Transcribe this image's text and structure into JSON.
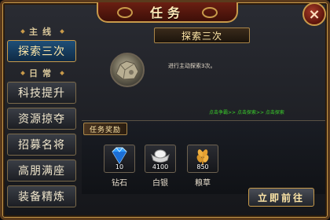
{
  "window": {
    "title": "任务",
    "close_label": "×"
  },
  "sidebar": {
    "main_header": "主线",
    "main_items": [
      {
        "label": "探索三次",
        "active": true
      }
    ],
    "daily_header": "日常",
    "daily_items": [
      {
        "label": "科技提升"
      },
      {
        "label": "资源掠夺"
      },
      {
        "label": "招募名将"
      },
      {
        "label": "高朋满座"
      },
      {
        "label": "装备精炼"
      }
    ]
  },
  "task": {
    "name": "探索三次",
    "description": "进行主动探索3次。",
    "hint": "点击争霸>> 点击探索>> 点击探索",
    "icon": "rock-icon"
  },
  "rewards": {
    "title": "任务奖励",
    "items": [
      {
        "icon": "diamond-icon",
        "count": "10",
        "label": "钻石"
      },
      {
        "icon": "silver-ingot-icon",
        "count": "4100",
        "label": "白银"
      },
      {
        "icon": "grain-icon",
        "count": "850",
        "label": "粮草"
      }
    ]
  },
  "actions": {
    "go_label": "立即前往"
  },
  "colors": {
    "accent_gold": "#c89a4a",
    "active_tab": "#1f4f78",
    "hint_green": "#3bd12b"
  }
}
